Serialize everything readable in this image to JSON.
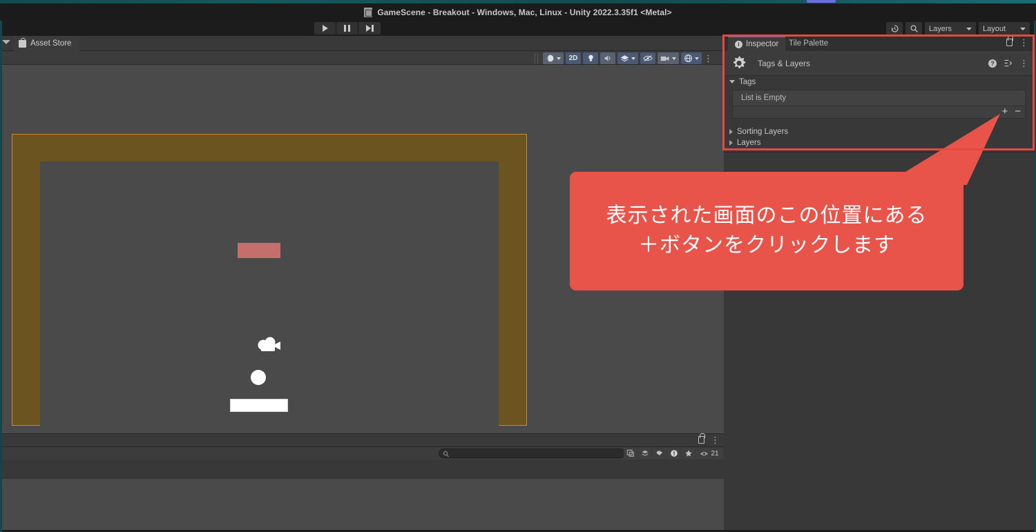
{
  "window": {
    "title": "GameScene - Breakout - Windows, Mac, Linux - Unity 2022.3.35f1 <Metal>",
    "scene_icon": "scene-file-icon"
  },
  "toolbar": {
    "play_label": "play-icon",
    "pause_label": "pause-icon",
    "step_label": "step-icon",
    "history_icon": "history-undo-icon",
    "search_icon": "search-icon",
    "layers_dropdown": "Layers",
    "layout_dropdown": "Layout"
  },
  "scene_panel": {
    "tab_label": "Asset Store",
    "tab_icon": "asset-store-bag-icon",
    "tools": [
      {
        "name": "shading-mode",
        "label": "",
        "icon": "sphere-icon",
        "has_caret": true
      },
      {
        "name": "2d-toggle",
        "label": "2D",
        "icon": "",
        "has_caret": false
      },
      {
        "name": "lighting-toggle",
        "label": "",
        "icon": "bulb-icon",
        "has_caret": false
      },
      {
        "name": "audio-toggle",
        "label": "",
        "icon": "speaker-icon",
        "has_caret": false
      },
      {
        "name": "fx-toggle",
        "label": "",
        "icon": "fx-icon",
        "has_caret": true
      },
      {
        "name": "hidden-objects-toggle",
        "label": "",
        "icon": "eye-slash-icon",
        "has_caret": false
      },
      {
        "name": "camera-toggle",
        "label": "",
        "icon": "camera-icon",
        "has_caret": true
      },
      {
        "name": "gizmos-toggle",
        "label": "",
        "icon": "gizmo-globe-icon",
        "has_caret": true
      }
    ],
    "objects": {
      "wall_color": "#6b5420",
      "wall_outline_color": "#c88a2e",
      "brick_color": "#c46f6b",
      "ball_color": "#ffffff",
      "paddle_color": "#ffffff",
      "background_color": "#4a4a4a",
      "camera_gizmo": "camera-gizmo-icon"
    }
  },
  "console_panel": {
    "lock_icon": "lock-icon",
    "menu_icon": "kebab-menu-icon",
    "search_placeholder": "",
    "search_value": "",
    "filters": [
      {
        "name": "log-filter",
        "icon": "log-icon",
        "count": ""
      },
      {
        "name": "warning-filter",
        "icon": "warning-icon",
        "count": ""
      },
      {
        "name": "favorite-filter",
        "icon": "star-icon",
        "count": ""
      },
      {
        "name": "visible-count",
        "icon": "eye-icon",
        "count": "21"
      }
    ]
  },
  "inspector": {
    "tabs": [
      {
        "label": "Inspector",
        "icon": "info-icon",
        "active": true
      },
      {
        "label": "Tile Palette",
        "icon": "",
        "active": false
      }
    ],
    "lock_icon": "lock-icon",
    "menu_icon": "kebab-menu-icon",
    "component": {
      "icon": "gear-settings-icon",
      "title": "Tags & Layers",
      "help_icon": "help-icon",
      "preset_icon": "preset-icon",
      "menu_icon": "kebab-menu-icon"
    },
    "sections": [
      {
        "label": "Tags",
        "expanded": true
      },
      {
        "label": "Sorting Layers",
        "expanded": false
      },
      {
        "label": "Layers",
        "expanded": false
      }
    ],
    "tags_list": {
      "empty_text": "List is Empty",
      "add_button": "+",
      "remove_button": "−"
    }
  },
  "annotation": {
    "outline_color": "#e8483f",
    "callout_color": "#e8544a",
    "text_color": "#ffffff",
    "lines": [
      "表示された画面のこの位置にある",
      "＋ボタンをクリックします"
    ]
  }
}
